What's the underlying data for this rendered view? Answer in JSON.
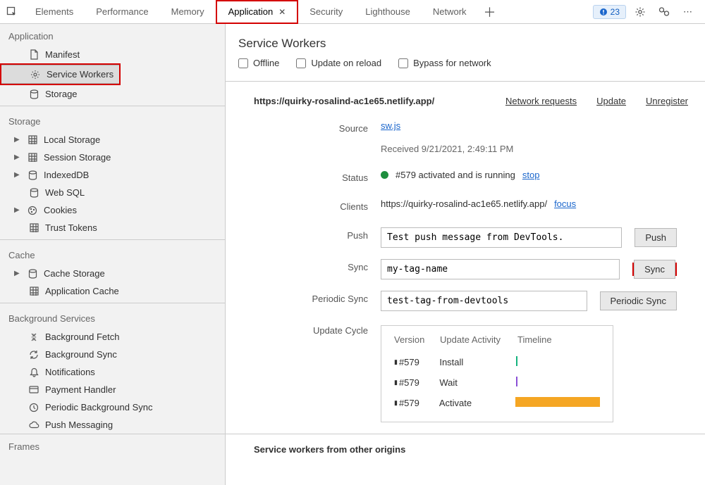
{
  "topbar": {
    "tabs": [
      "Elements",
      "Performance",
      "Memory",
      "Application",
      "Security",
      "Lighthouse",
      "Network"
    ],
    "active_tab": "Application",
    "issue_count": "23"
  },
  "sidebar": {
    "sections": {
      "application": {
        "title": "Application",
        "items": [
          "Manifest",
          "Service Workers",
          "Storage"
        ]
      },
      "storage": {
        "title": "Storage",
        "items": [
          "Local Storage",
          "Session Storage",
          "IndexedDB",
          "Web SQL",
          "Cookies",
          "Trust Tokens"
        ]
      },
      "cache": {
        "title": "Cache",
        "items": [
          "Cache Storage",
          "Application Cache"
        ]
      },
      "bg": {
        "title": "Background Services",
        "items": [
          "Background Fetch",
          "Background Sync",
          "Notifications",
          "Payment Handler",
          "Periodic Background Sync",
          "Push Messaging"
        ]
      },
      "frames": {
        "title": "Frames"
      }
    }
  },
  "sw": {
    "title": "Service Workers",
    "checks": {
      "offline": "Offline",
      "update": "Update on reload",
      "bypass": "Bypass for network"
    },
    "origin": "https://quirky-rosalind-ac1e65.netlify.app/",
    "links": {
      "netreq": "Network requests",
      "update": "Update",
      "unreg": "Unregister"
    },
    "source": {
      "label": "Source",
      "file": "sw.js",
      "received": "Received 9/21/2021, 2:49:11 PM"
    },
    "status": {
      "label": "Status",
      "text": "#579 activated and is running",
      "stop": "stop"
    },
    "clients": {
      "label": "Clients",
      "url": "https://quirky-rosalind-ac1e65.netlify.app/",
      "focus": "focus"
    },
    "push": {
      "label": "Push",
      "value": "Test push message from DevTools.",
      "btn": "Push"
    },
    "sync": {
      "label": "Sync",
      "value": "my-tag-name",
      "btn": "Sync"
    },
    "psync": {
      "label": "Periodic Sync",
      "value": "test-tag-from-devtools",
      "btn": "Periodic Sync"
    },
    "cycle": {
      "label": "Update Cycle",
      "cols": [
        "Version",
        "Update Activity",
        "Timeline"
      ],
      "rows": [
        {
          "v": "#579",
          "a": "Install",
          "color": "#14b37d"
        },
        {
          "v": "#579",
          "a": "Wait",
          "color": "#8a4fd6"
        },
        {
          "v": "#579",
          "a": "Activate",
          "bar": true
        }
      ]
    },
    "other": "Service workers from other origins"
  }
}
